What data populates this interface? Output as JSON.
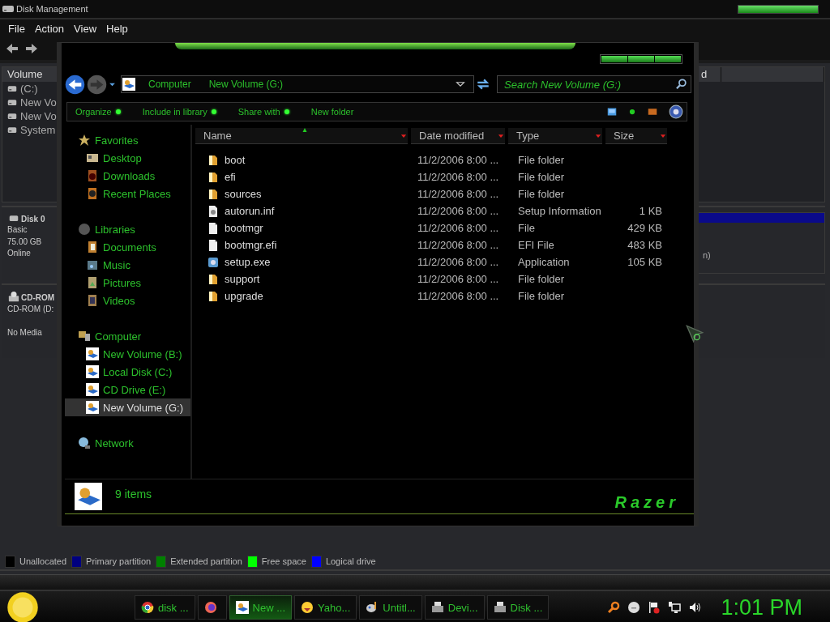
{
  "background_window": {
    "title": "Disk Management",
    "menu": [
      "File",
      "Action",
      "View",
      "Help"
    ],
    "volume_list": {
      "columns": [
        "Volume",
        "d"
      ],
      "rows": [
        "(C:)",
        "New Vo",
        "New Vo",
        "System"
      ]
    },
    "disks": [
      {
        "kind": "disk",
        "name": "Disk 0",
        "type": "Basic",
        "size": "75.00 GB",
        "status": "Online",
        "partition_text": "n)"
      },
      {
        "kind": "cdrom",
        "name": "CD-ROM",
        "type": "CD-ROM (D:",
        "status": "No Media"
      }
    ],
    "legend": [
      {
        "label": "Unallocated",
        "color": "#000000"
      },
      {
        "label": "Primary partition",
        "color": "#000080"
      },
      {
        "label": "Extended partition",
        "color": "#008000"
      },
      {
        "label": "Free space",
        "color": "#00ff00"
      },
      {
        "label": "Logical drive",
        "color": "#0000ff"
      }
    ]
  },
  "explorer": {
    "breadcrumb": [
      "Computer",
      "New Volume (G:)"
    ],
    "search": {
      "placeholder": "Search New Volume (G:)"
    },
    "commands": [
      {
        "label": "Organize",
        "menu": true
      },
      {
        "label": "Include in library",
        "menu": true
      },
      {
        "label": "Share with",
        "menu": true
      },
      {
        "label": "New folder",
        "menu": false
      }
    ],
    "nav": [
      {
        "label": "Favorites",
        "kind": "star",
        "selected": false,
        "children": [
          {
            "label": "Desktop",
            "kind": "desktop",
            "selected": false
          },
          {
            "label": "Downloads",
            "kind": "downloads",
            "selected": false
          },
          {
            "label": "Recent Places",
            "kind": "recent",
            "selected": false
          }
        ]
      },
      {
        "label": "Libraries",
        "kind": "library",
        "selected": false,
        "children": [
          {
            "label": "Documents",
            "kind": "documents",
            "selected": false
          },
          {
            "label": "Music",
            "kind": "music",
            "selected": false
          },
          {
            "label": "Pictures",
            "kind": "pictures",
            "selected": false
          },
          {
            "label": "Videos",
            "kind": "videos",
            "selected": false
          }
        ]
      },
      {
        "label": "Computer",
        "kind": "computer",
        "selected": false,
        "children": [
          {
            "label": "New Volume (B:)",
            "kind": "drive",
            "selected": false
          },
          {
            "label": "Local Disk (C:)",
            "kind": "drive",
            "selected": false
          },
          {
            "label": "CD Drive (E:)",
            "kind": "drive",
            "selected": false
          },
          {
            "label": "New Volume (G:)",
            "kind": "drive",
            "selected": true
          }
        ]
      },
      {
        "label": "Network",
        "kind": "network",
        "selected": false
      }
    ],
    "columns": [
      {
        "label": "Name",
        "sorted": true
      },
      {
        "label": "Date modified",
        "sorted": false
      },
      {
        "label": "Type",
        "sorted": false
      },
      {
        "label": "Size",
        "sorted": false
      }
    ],
    "files": [
      {
        "name": "boot",
        "date": "11/2/2006 8:00 ...",
        "type": "File folder",
        "kind": "folder"
      },
      {
        "name": "efi",
        "date": "11/2/2006 8:00 ...",
        "type": "File folder",
        "kind": "folder"
      },
      {
        "name": "sources",
        "date": "11/2/2006 8:00 ...",
        "type": "File folder",
        "kind": "folder"
      },
      {
        "name": "autorun.inf",
        "date": "11/2/2006 8:00 ...",
        "type": "Setup Information",
        "size": "1 KB",
        "kind": "settings"
      },
      {
        "name": "bootmgr",
        "date": "11/2/2006 8:00 ...",
        "type": "File",
        "size": "429 KB",
        "kind": "file"
      },
      {
        "name": "bootmgr.efi",
        "date": "11/2/2006 8:00 ...",
        "type": "EFI File",
        "size": "483 KB",
        "kind": "file"
      },
      {
        "name": "setup.exe",
        "date": "11/2/2006 8:00 ...",
        "type": "Application",
        "size": "105 KB",
        "kind": "setup"
      },
      {
        "name": "support",
        "date": "11/2/2006 8:00 ...",
        "type": "File folder",
        "kind": "folder"
      },
      {
        "name": "upgrade",
        "date": "11/2/2006 8:00 ...",
        "type": "File folder",
        "kind": "folder"
      }
    ],
    "status": "9 items",
    "logo": "Razer"
  },
  "taskbar": {
    "items": [
      {
        "label": "disk ...",
        "kind": "chrome",
        "selected": false
      },
      {
        "kind": "firefox",
        "selected": false
      },
      {
        "label": "New ...",
        "kind": "drive",
        "selected": true
      },
      {
        "label": "Yaho...",
        "kind": "messenger",
        "selected": false
      },
      {
        "label": "Untitl...",
        "kind": "paint",
        "selected": false
      },
      {
        "label": "Devi...",
        "kind": "devices",
        "selected": false
      },
      {
        "label": "Disk ...",
        "kind": "devices",
        "selected": false
      }
    ],
    "clock": "1:01 PM"
  }
}
